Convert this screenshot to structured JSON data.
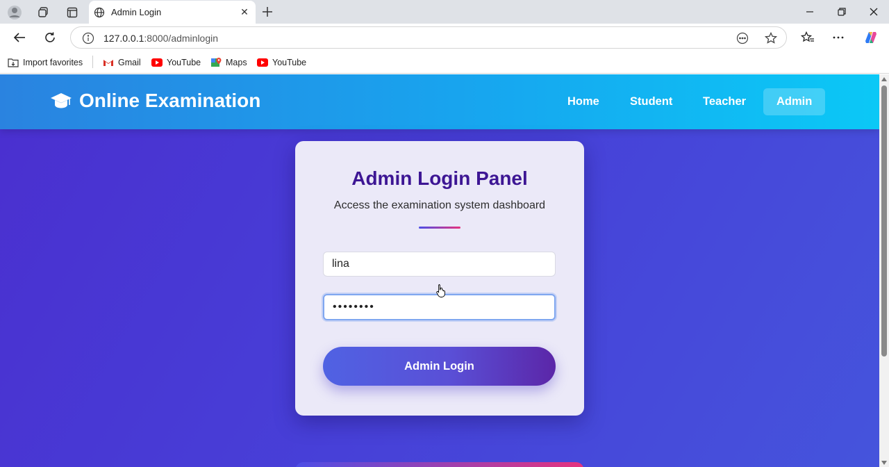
{
  "browser": {
    "tab_title": "Admin Login",
    "url_host": "127.0.0.1",
    "url_path": ":8000/adminlogin",
    "bookmarks": [
      "Import favorites",
      "Gmail",
      "YouTube",
      "Maps",
      "YouTube"
    ]
  },
  "site": {
    "brand": "Online Examination",
    "nav": [
      "Home",
      "Student",
      "Teacher",
      "Admin"
    ],
    "active_nav": "Admin"
  },
  "login": {
    "heading": "Admin Login Panel",
    "subtitle": "Access the examination system dashboard",
    "username_value": "lina",
    "password_value": "••••••••",
    "button_label": "Admin Login"
  },
  "colors": {
    "nav_gradient_start": "#2a83e0",
    "nav_gradient_end": "#0bc8f6",
    "page_background": "#4740d8",
    "heading": "#3d1694",
    "button_start": "#5062e3",
    "button_end": "#5b26a8"
  }
}
